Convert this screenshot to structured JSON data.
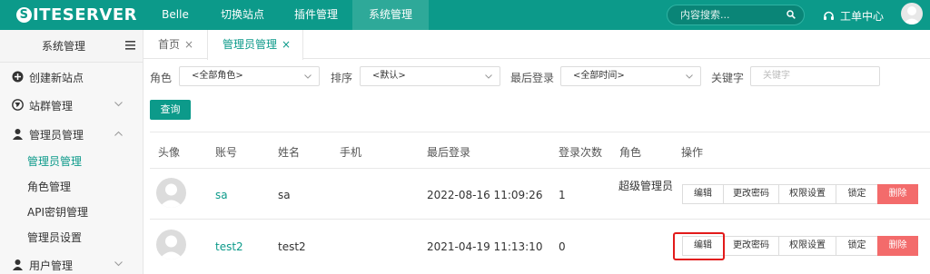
{
  "app": {
    "logo_text": "ITESERVER",
    "logo_letter": "S",
    "nav": [
      "Belle",
      "切换站点",
      "插件管理",
      "系统管理"
    ],
    "search_placeholder": "内容搜索...",
    "ticket_label": "工单中心"
  },
  "sidebar": {
    "title": "系统管理",
    "items": [
      {
        "label": "创建新站点"
      },
      {
        "label": "站群管理"
      },
      {
        "label": "管理员管理"
      },
      {
        "label": "用户管理"
      }
    ],
    "sub_items": [
      {
        "label": "管理员管理"
      },
      {
        "label": "角色管理"
      },
      {
        "label": "API密钥管理"
      },
      {
        "label": "管理员设置"
      }
    ]
  },
  "tabs": [
    {
      "label": "首页",
      "close": "×"
    },
    {
      "label": "管理员管理",
      "close": "×"
    }
  ],
  "filters": {
    "role_label": "角色",
    "role_value": "<全部角色>",
    "sort_label": "排序",
    "sort_value": "<默认>",
    "last_login_label": "最后登录",
    "last_login_value": "<全部时间>",
    "keyword_label": "关键字",
    "keyword_placeholder": "关键字",
    "query_button": "查询"
  },
  "table": {
    "headers": [
      "头像",
      "账号",
      "姓名",
      "手机",
      "最后登录",
      "登录次数",
      "角色",
      "操作"
    ],
    "rows": [
      {
        "account": "sa",
        "name": "sa",
        "phone": "",
        "last_login": "2022-08-16 11:09:26",
        "login_count": "1",
        "role": "超级管理员"
      },
      {
        "account": "test2",
        "name": "test2",
        "phone": "",
        "last_login": "2021-04-19 11:13:10",
        "login_count": "0",
        "role": ""
      }
    ],
    "actions": [
      "编辑",
      "更改密码",
      "权限设置",
      "锁定",
      "删除"
    ]
  },
  "colors": {
    "brand": "#0c9a8a",
    "danger": "#f36b6b",
    "highlight": "#e21a1a"
  }
}
